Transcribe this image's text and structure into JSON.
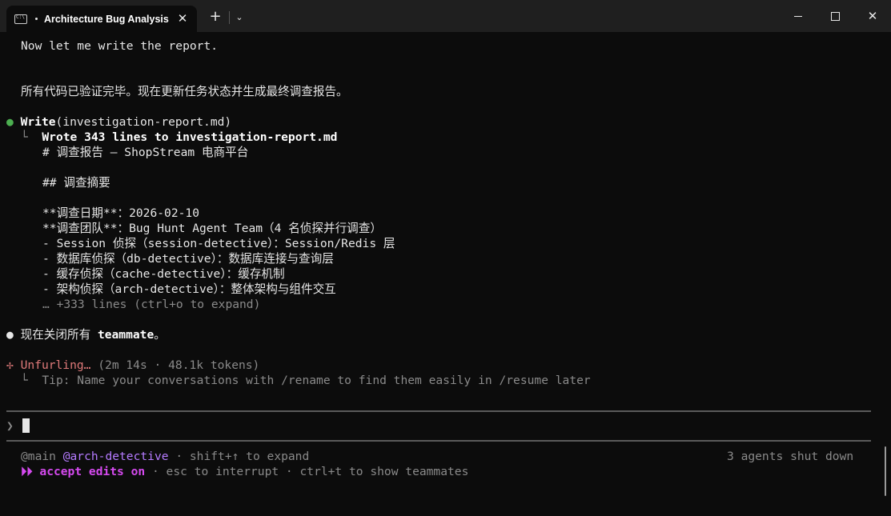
{
  "window": {
    "tab_title": "Architecture Bug Analysis",
    "tab_icon": "terminal-icon",
    "close_tab_glyph": "✕",
    "new_tab_glyph": "+",
    "dropdown_glyph": "⌄",
    "close_glyph": "✕"
  },
  "transcript": {
    "line1": "Now let me write the report.",
    "line2": "所有代码已验证完毕。现在更新任务状态并生成最终调查报告。",
    "write_tool": "Write",
    "write_args": "(investigation-report.md)",
    "wrote_prefix": "Wrote ",
    "wrote_count": "343",
    "wrote_mid": " lines to ",
    "wrote_file": "investigation-report.md",
    "report_lines": [
      "# 调查报告 – ShopStream 电商平台",
      "",
      "## 调查摘要",
      "",
      "**调查日期**：2026-02-10",
      "**调查团队**：Bug Hunt Agent Team（4 名侦探并行调查）",
      "- Session 侦探（session-detective）：Session/Redis 层",
      "- 数据库侦探（db-detective）：数据库连接与查询层",
      "- 缓存侦探（cache-detective）：缓存机制",
      "- 架构侦探（arch-detective）：整体架构与组件交互"
    ],
    "more_lines": "… +333 lines (ctrl+o to expand)",
    "shutdown_msg_prefix": "现在关闭所有 ",
    "shutdown_msg_bold": "teammate",
    "shutdown_msg_suffix": "。",
    "status_glyph": "✢",
    "status_word": "Unfurling…",
    "status_detail": " (2m 14s · 48.1k tokens)",
    "tip": "Tip: Name your conversations with /rename to find them easily in /resume later"
  },
  "prompt": {
    "chevron": "❯"
  },
  "footer": {
    "main_tag": "@main",
    "agent_tag": "@arch-detective",
    "expand_hint": " · shift+↑ to expand",
    "right_status": "3 agents shut down",
    "mode_glyph": "⏵⏵",
    "mode_label": "accept edits on",
    "mode_hint": " · esc to interrupt · ctrl+t to show teammates"
  },
  "colors": {
    "background": "#0c0c0c",
    "status": "#e07a7a",
    "agent": "#b57bff",
    "accept_edits": "#d64af0",
    "bullet_success": "#4caf50"
  }
}
